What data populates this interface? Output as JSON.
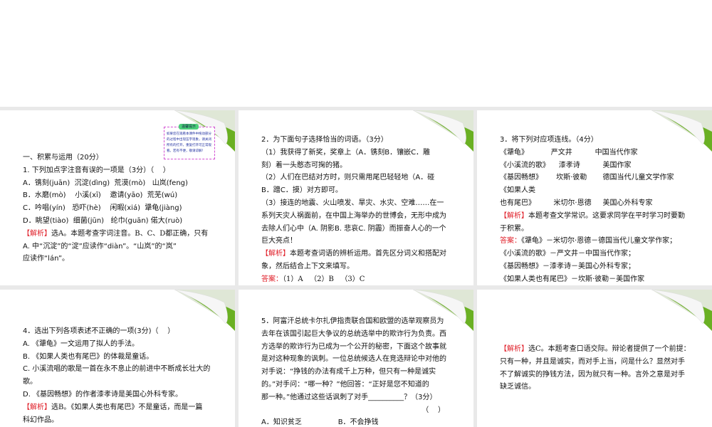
{
  "accent_green": "#6ab023",
  "label_red": "#e0202a",
  "slides": [
    {
      "tip": {
        "title": "温馨提示",
        "body": "如果您在观看本课件中拖动部分的过程中出现压字现象，请关闭所有的打开，重复打开可正常观看。若有不便，敬请谅解！"
      },
      "lines": [
        {
          "text": "一、积累与运用（20分）"
        },
        {
          "text": "1. 下列加点字注音有误的一项是（3分）（    ）"
        },
        {
          "text": "A．镌刻(juān)  沉淀(dìng)  荒漠(mò)   山岚(feng)"
        },
        {
          "text": "B．水磨(mò)    小溪(xī)    邀请(yāo)  荒芜(wú)"
        },
        {
          "text": "C．吟唱(yín)   恐吓(hè)    闲暇(xiá)  犟龟(jiàng)"
        },
        {
          "text": "D．眺望(tiào)  细菌(jūn)   纶巾(guān) 偌大(ruò)"
        },
        {
          "label": "【解析】",
          "text": "选A。本题考查字词注音。B、C、D都正确，只有"
        },
        {
          "text": "A. 中“沉淀”的“淀”应读作“diàn”。“山岚”的“岚”"
        },
        {
          "text": "应读作“lán”。"
        }
      ]
    },
    {
      "lines": [
        {
          "text": "2．为下面句子选择恰当的词语。（3分）"
        },
        {
          "text": "（1）我获得了新奖，奖章上（A．镌刻B．镶嵌C．雕"
        },
        {
          "text": "刻）着一头憨态可掬的猪。"
        },
        {
          "text": "（2）人们在巴结对方时，则只需用尾巴轻轻地（A．碰"
        },
        {
          "text": "B．蹭C．摸）对方即可。"
        },
        {
          "text": "（3）接连的地震、火山喷发、旱灾、水灾、空难……在一"
        },
        {
          "text": "系列天灾人祸面前，在中国上海举办的世博会，无形中成为"
        },
        {
          "text": "去除人们心中（A. 阴影B. 悲哀C. 阴霾）而振奋人心的一个"
        },
        {
          "text": "巨大亮点！"
        },
        {
          "label": "【解析】",
          "text": "本题考查词语的辨析运用。首先区分词义和搭配对"
        },
        {
          "text": "象，然后结合上下文来填写。"
        },
        {
          "label": "答案：",
          "text": "（1）A   （2）B   （3）C"
        }
      ]
    },
    {
      "lines": [
        {
          "text": "3．将下列对应项连线。（4分）"
        },
        {
          "text": "《犟龟》          严文井          中国当代作家"
        },
        {
          "text": "《小溪流的歌》    漆孝诗          美国作家"
        },
        {
          "text": "《基因畅想》      坎斯·彼勒       德国当代儿童文学作家"
        },
        {
          "text": "《如果人类"
        },
        {
          "text": "也有尾巴》        米切尔·恩德     美国心外科专家"
        },
        {
          "label": "【解析】",
          "text": "本题考查文学常识。这要求同学在平时学习时要勤"
        },
        {
          "text": "于积累。"
        },
        {
          "label": "答案：",
          "text": "《犟龟》－米切尔·恩德－德国当代儿童文学作家；"
        },
        {
          "text": "《小溪流的歌》－严文井－中国当代作家；"
        },
        {
          "text": "《基因畅想》－漆孝诗－美国心外科专家；"
        },
        {
          "text": "《如果人类也有尾巴》－坎斯·彼勒－美国作家"
        }
      ]
    },
    {
      "lines": [
        {
          "text": "4．选出下列各项表述不正确的一项(3分)（    ）"
        },
        {
          "text": "A. 《犟龟》一文运用了拟人的手法。"
        },
        {
          "text": "B. 《如果人类也有尾巴》的体裁是童话。"
        },
        {
          "text": "C. 小溪流唱的歌是一首在永不息止的前进中不断成长壮大的"
        },
        {
          "text": "歌。"
        },
        {
          "text": "D. 《基因畅想》的作者漆孝诗是美国心外科专家。"
        },
        {
          "label": "【解析】",
          "text": "选B。《如果人类也有尾巴》不是童话，而是一篇"
        },
        {
          "text": "科幻作品。"
        }
      ]
    },
    {
      "lines": [
        {
          "text": "5．阿富汗总统卡尔扎伊指责联合国和欧盟的选举观察员为"
        },
        {
          "text": "去年在该国引起巨大争议的总统选举中的欺诈行为负责。西"
        },
        {
          "text": "方选举的欺诈行为已成为一个公开的秘密，下面这个故事就"
        },
        {
          "text": "是对这种现象的讽刺。一位总统候选人在竞选辩论中对他的"
        },
        {
          "text": "对手说：“挣钱的办法有成千上万种，但只有一种是诚实"
        },
        {
          "text": "的。”对手问：“哪一种？”他回答：“正好是您不知道的"
        },
        {
          "text": "那一种。”他通过这些话讽刺了对手__________？（3分）"
        },
        {
          "text": "（    ）",
          "align": "right"
        },
        {
          "text": "A．知识贫乏                B．不会挣钱"
        }
      ]
    },
    {
      "lines": [
        {
          "label": "【解析】",
          "text": "选C。本题考查口语交际。辩论者提供了一个前提："
        },
        {
          "text": "只有一种，并且是诚实，而对手上当，问是什么？显然对手"
        },
        {
          "text": "不了解诚实的挣钱方法，因为就只有一种。言外之意是对手"
        },
        {
          "text": "缺乏诚信。"
        }
      ]
    }
  ]
}
